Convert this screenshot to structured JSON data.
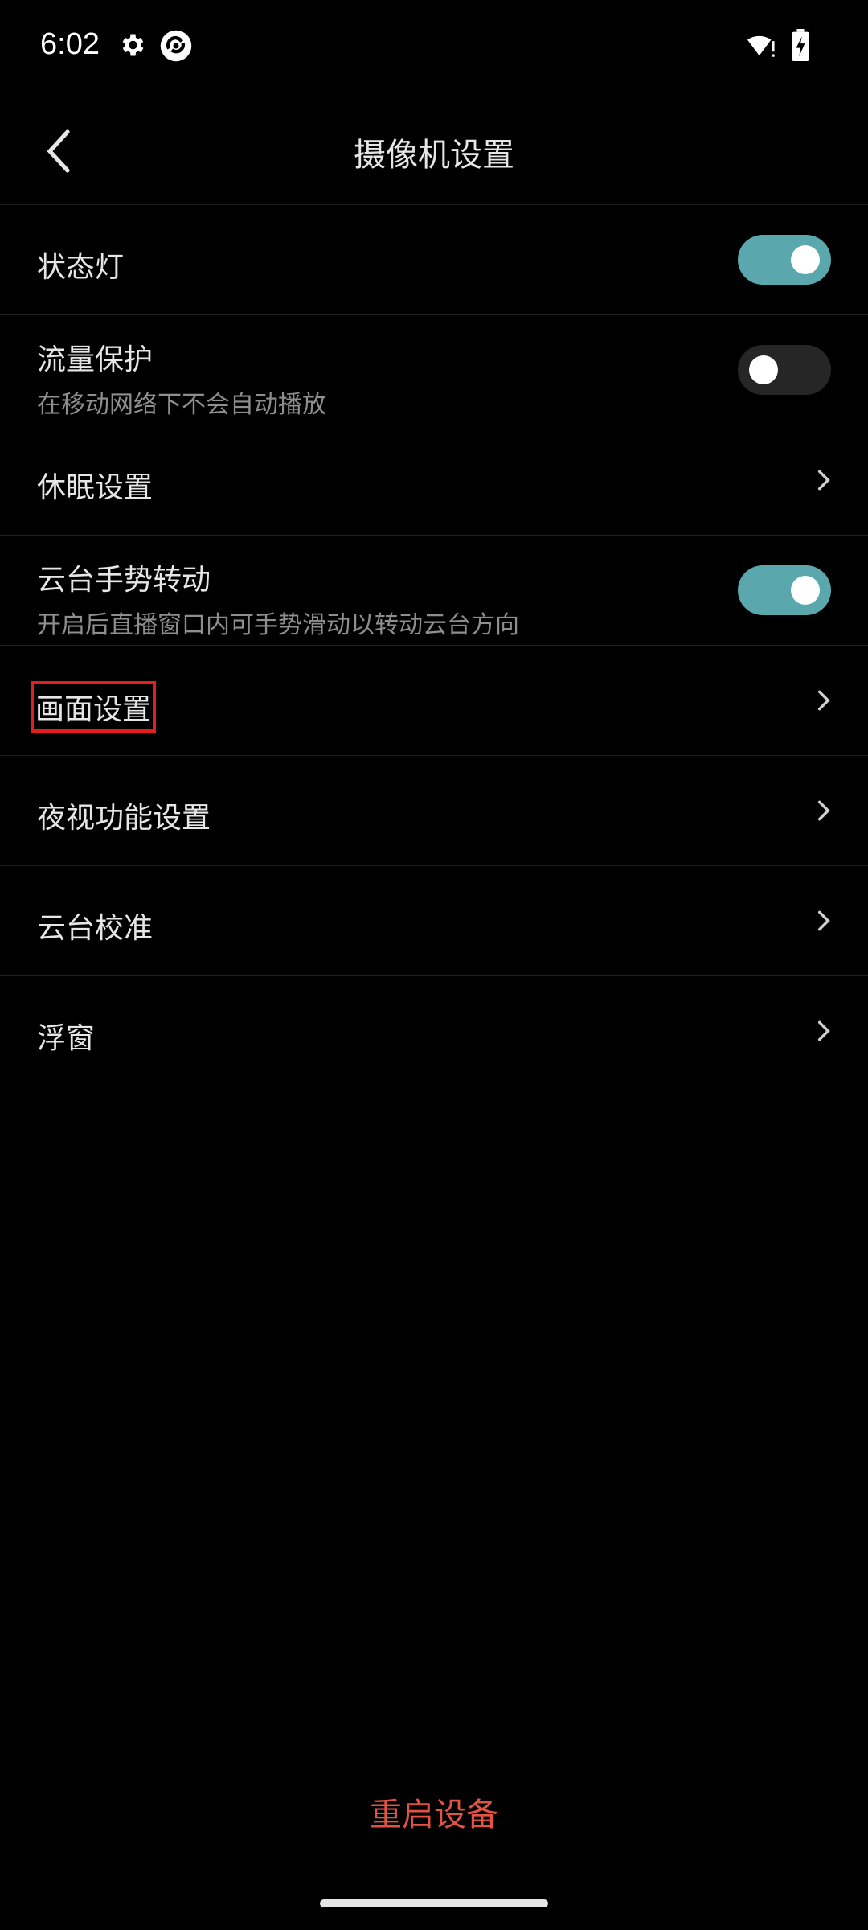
{
  "status_bar": {
    "time": "6:02",
    "icons": [
      "gear-icon",
      "app-logo-icon",
      "wifi-alert-icon",
      "battery-charging-icon"
    ]
  },
  "app_bar": {
    "title": "摄像机设置",
    "back_icon": "chevron-left-icon"
  },
  "settings": [
    {
      "label": "状态灯",
      "type": "toggle",
      "state": "on"
    },
    {
      "label": "流量保护",
      "desc": "在移动网络下不会自动播放",
      "type": "toggle",
      "state": "off"
    },
    {
      "label": "休眠设置",
      "type": "nav"
    },
    {
      "label": "云台手势转动",
      "desc": "开启后直播窗口内可手势滑动以转动云台方向",
      "type": "toggle",
      "state": "on"
    },
    {
      "label": "画面设置",
      "type": "nav",
      "highlighted": true
    },
    {
      "label": "夜视功能设置",
      "type": "nav"
    },
    {
      "label": "云台校准",
      "type": "nav"
    },
    {
      "label": "浮窗",
      "type": "nav"
    }
  ],
  "footer": {
    "restart_label": "重启设备"
  },
  "colors": {
    "accent": "#5aa8ae",
    "danger": "#e25343",
    "highlight_box": "#e41e1e"
  }
}
